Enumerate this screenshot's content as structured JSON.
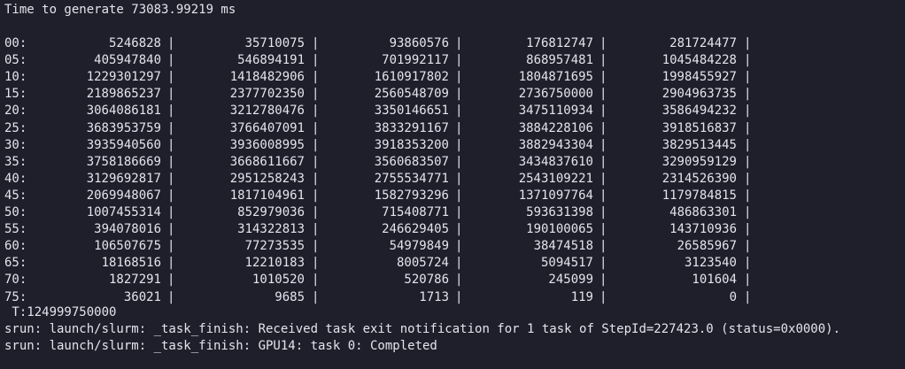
{
  "terminal": {
    "header": "Time to generate 73083.99219 ms",
    "separator": "|",
    "rows": [
      {
        "idx": "00:",
        "values": [
          "5246828",
          "35710075",
          "93860576",
          "176812747",
          "281724477"
        ]
      },
      {
        "idx": "05:",
        "values": [
          "405947840",
          "546894191",
          "701992117",
          "868957481",
          "1045484228"
        ]
      },
      {
        "idx": "10:",
        "values": [
          "1229301297",
          "1418482906",
          "1610917802",
          "1804871695",
          "1998455927"
        ]
      },
      {
        "idx": "15:",
        "values": [
          "2189865237",
          "2377702350",
          "2560548709",
          "2736750000",
          "2904963735"
        ]
      },
      {
        "idx": "20:",
        "values": [
          "3064086181",
          "3212780476",
          "3350146651",
          "3475110934",
          "3586494232"
        ]
      },
      {
        "idx": "25:",
        "values": [
          "3683953759",
          "3766407091",
          "3833291167",
          "3884228106",
          "3918516837"
        ]
      },
      {
        "idx": "30:",
        "values": [
          "3935940560",
          "3936008995",
          "3918353200",
          "3882943304",
          "3829513445"
        ]
      },
      {
        "idx": "35:",
        "values": [
          "3758186669",
          "3668611667",
          "3560683507",
          "3434837610",
          "3290959129"
        ]
      },
      {
        "idx": "40:",
        "values": [
          "3129692817",
          "2951258243",
          "2755534771",
          "2543109221",
          "2314526390"
        ]
      },
      {
        "idx": "45:",
        "values": [
          "2069948067",
          "1817104961",
          "1582793296",
          "1371097764",
          "1179784815"
        ]
      },
      {
        "idx": "50:",
        "values": [
          "1007455314",
          "852979036",
          "715408771",
          "593631398",
          "486863301"
        ]
      },
      {
        "idx": "55:",
        "values": [
          "394078016",
          "314322813",
          "246629405",
          "190100065",
          "143710936"
        ]
      },
      {
        "idx": "60:",
        "values": [
          "106507675",
          "77273535",
          "54979849",
          "38474518",
          "26585967"
        ]
      },
      {
        "idx": "65:",
        "values": [
          "18168516",
          "12210183",
          "8005724",
          "5094517",
          "3123540"
        ]
      },
      {
        "idx": "70:",
        "values": [
          "1827291",
          "1010520",
          "520786",
          "245099",
          "101604"
        ]
      },
      {
        "idx": "75:",
        "values": [
          "36021",
          "9685",
          "1713",
          "119",
          "0"
        ]
      }
    ],
    "total": " T:124999750000",
    "srun_lines": [
      "srun: launch/slurm: _task_finish: Received task exit notification for 1 task of StepId=227423.0 (status=0x0000).",
      "srun: launch/slurm: _task_finish: GPU14: task 0: Completed"
    ]
  }
}
